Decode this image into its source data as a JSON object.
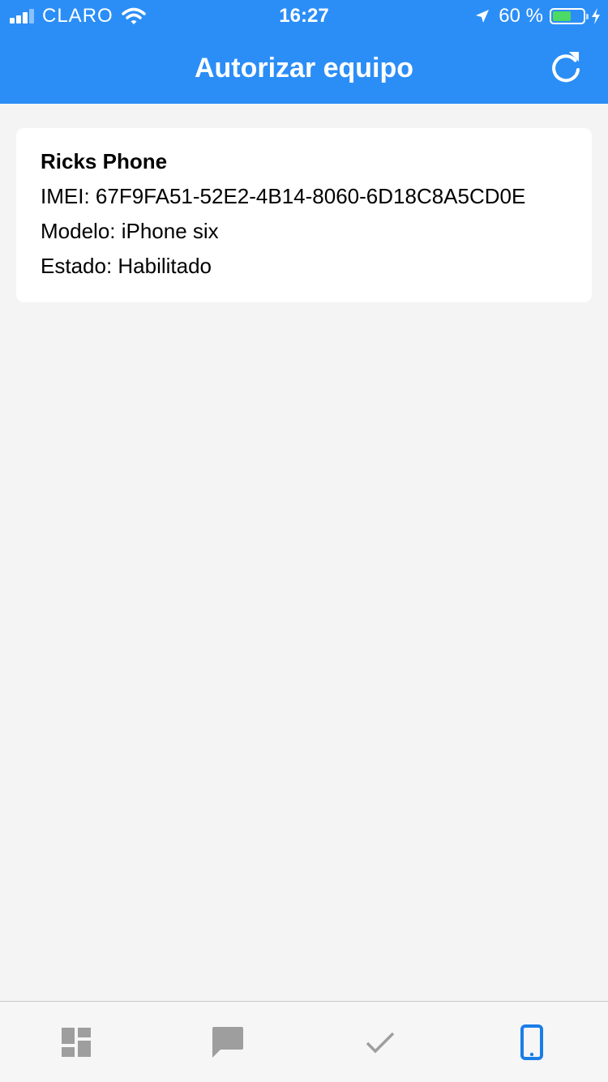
{
  "status_bar": {
    "carrier": "CLARO",
    "time": "16:27",
    "battery_percent": "60 %",
    "battery_level": 0.6,
    "icons": [
      "signal-icon",
      "wifi-icon",
      "location-icon",
      "battery-icon",
      "charging-icon"
    ]
  },
  "header": {
    "title": "Autorizar equipo",
    "refresh_icon": "refresh-icon"
  },
  "device": {
    "name": "Ricks Phone",
    "imei": "IMEI: 67F9FA51-52E2-4B14-8060-6D18C8A5CD0E",
    "model": "Modelo: iPhone six",
    "status": "Estado: Habilitado"
  },
  "tabbar": {
    "tabs": [
      {
        "icon": "dashboard-icon",
        "active": false
      },
      {
        "icon": "message-icon",
        "active": false
      },
      {
        "icon": "checkmark-icon",
        "active": false
      },
      {
        "icon": "phone-icon",
        "active": true
      }
    ]
  },
  "colors": {
    "header_bg": "#2b8ef7",
    "page_bg": "#f4f4f4",
    "tab_inactive": "#9e9e9e",
    "tab_active": "#1a7de8",
    "battery_fill": "#4cd964"
  }
}
